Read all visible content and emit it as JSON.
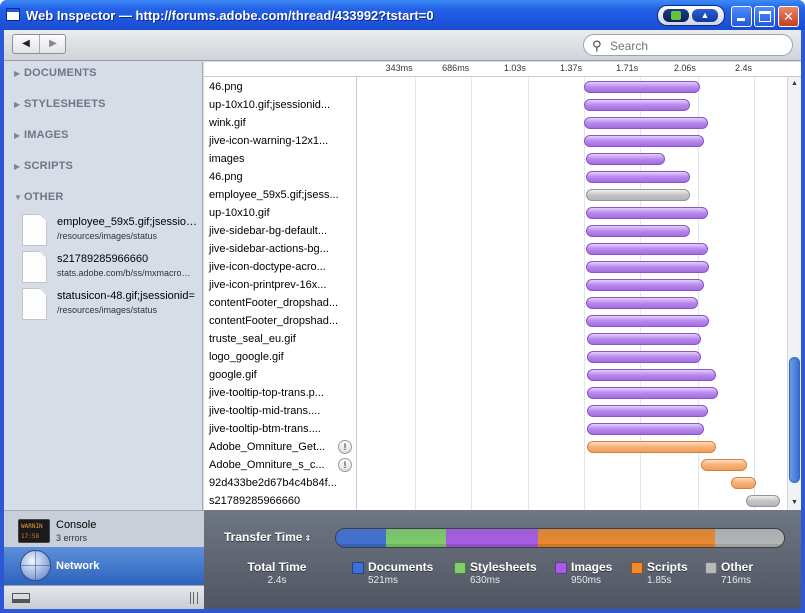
{
  "window": {
    "title": "Web Inspector — http://forums.adobe.com/thread/433992?tstart=0",
    "tray_label": "▲"
  },
  "toolbar": {
    "back_glyph": "◀",
    "forward_glyph": "▶",
    "search_placeholder": "Search",
    "search_icon": "⚲"
  },
  "sidebar": {
    "sections": [
      {
        "label": "DOCUMENTS",
        "expanded": false
      },
      {
        "label": "STYLESHEETS",
        "expanded": false
      },
      {
        "label": "IMAGES",
        "expanded": false
      },
      {
        "label": "SCRIPTS",
        "expanded": false
      },
      {
        "label": "OTHER",
        "expanded": true
      }
    ],
    "other_items": [
      {
        "name": "employee_59x5.gif;jsessionid=",
        "path": "/resources/images/status"
      },
      {
        "name": "s21789285966660",
        "path": "stats.adobe.com/b/ss/mxmacromedia"
      },
      {
        "name": "statusicon-48.gif;jsessionid=",
        "path": "/resources/images/status"
      }
    ],
    "console": {
      "label": "Console",
      "sub": "3 errors",
      "screen_line1": "WARNIN",
      "screen_line2": "17:58"
    },
    "network": {
      "label": "Network"
    }
  },
  "timeline": {
    "ticks": [
      "343ms",
      "686ms",
      "1.03s",
      "1.37s",
      "1.71s",
      "2.06s",
      "2.4s"
    ],
    "resources": [
      {
        "name": "46.png",
        "type": "images",
        "start": 1.37,
        "end": 2.07,
        "warn": false
      },
      {
        "name": "up-10x10.gif;jsessionid...",
        "type": "images",
        "start": 1.37,
        "end": 2.01,
        "warn": false
      },
      {
        "name": "wink.gif",
        "type": "images",
        "start": 1.37,
        "end": 2.12,
        "warn": false
      },
      {
        "name": "jive-icon-warning-12x1...",
        "type": "images",
        "start": 1.37,
        "end": 2.1,
        "warn": false
      },
      {
        "name": "images",
        "type": "images",
        "start": 1.38,
        "end": 1.86,
        "warn": false
      },
      {
        "name": "46.png",
        "type": "images",
        "start": 1.38,
        "end": 2.01,
        "warn": false
      },
      {
        "name": "employee_59x5.gif;jsess...",
        "type": "other",
        "start": 1.38,
        "end": 2.01,
        "warn": false
      },
      {
        "name": "up-10x10.gif",
        "type": "images",
        "start": 1.38,
        "end": 2.12,
        "warn": false
      },
      {
        "name": "jive-sidebar-bg-default...",
        "type": "images",
        "start": 1.38,
        "end": 2.01,
        "warn": false
      },
      {
        "name": "jive-sidebar-actions-bg...",
        "type": "images",
        "start": 1.38,
        "end": 2.12,
        "warn": false
      },
      {
        "name": "jive-icon-doctype-acro...",
        "type": "images",
        "start": 1.38,
        "end": 2.13,
        "warn": false
      },
      {
        "name": "jive-icon-printprev-16x...",
        "type": "images",
        "start": 1.38,
        "end": 2.1,
        "warn": false
      },
      {
        "name": "contentFooter_dropshad...",
        "type": "images",
        "start": 1.38,
        "end": 2.06,
        "warn": false
      },
      {
        "name": "contentFooter_dropshad...",
        "type": "images",
        "start": 1.38,
        "end": 2.13,
        "warn": false
      },
      {
        "name": "truste_seal_eu.gif",
        "type": "images",
        "start": 1.39,
        "end": 2.08,
        "warn": false
      },
      {
        "name": "logo_google.gif",
        "type": "images",
        "start": 1.39,
        "end": 2.08,
        "warn": false
      },
      {
        "name": "google.gif",
        "type": "images",
        "start": 1.39,
        "end": 2.17,
        "warn": false
      },
      {
        "name": "jive-tooltip-top-trans.p...",
        "type": "images",
        "start": 1.39,
        "end": 2.18,
        "warn": false
      },
      {
        "name": "jive-tooltip-mid-trans....",
        "type": "images",
        "start": 1.39,
        "end": 2.12,
        "warn": false
      },
      {
        "name": "jive-tooltip-btm-trans....",
        "type": "images",
        "start": 1.39,
        "end": 2.1,
        "warn": false
      },
      {
        "name": "Adobe_Omniture_Get...",
        "type": "scripts",
        "start": 1.39,
        "end": 2.17,
        "warn": true
      },
      {
        "name": "Adobe_Omniture_s_c...",
        "type": "scripts",
        "start": 2.08,
        "end": 2.36,
        "warn": true
      },
      {
        "name": "92d433be2d67b4c4b84f...",
        "type": "scripts",
        "start": 2.26,
        "end": 2.41,
        "warn": false
      },
      {
        "name": "s21789285966660",
        "type": "other",
        "start": 2.35,
        "end": 2.56,
        "warn": false
      }
    ],
    "warn_glyph": "!"
  },
  "summary": {
    "transfer_label": "Transfer Time",
    "sort_glyph": "⇕",
    "total": {
      "label": "Total Time",
      "value": "2.4s"
    },
    "categories": [
      {
        "key": "documents",
        "label": "Documents",
        "value": "521ms",
        "ms": 521,
        "color": "#3f6fd8"
      },
      {
        "key": "stylesheets",
        "label": "Stylesheets",
        "value": "630ms",
        "ms": 630,
        "color": "#7fcf6a"
      },
      {
        "key": "images",
        "label": "Images",
        "value": "950ms",
        "ms": 950,
        "color": "#a95ce8"
      },
      {
        "key": "scripts",
        "label": "Scripts",
        "value": "1.85s",
        "ms": 1850,
        "color": "#f08a2a"
      },
      {
        "key": "other",
        "label": "Other",
        "value": "716ms",
        "ms": 716,
        "color": "#b9b9b9"
      }
    ]
  }
}
